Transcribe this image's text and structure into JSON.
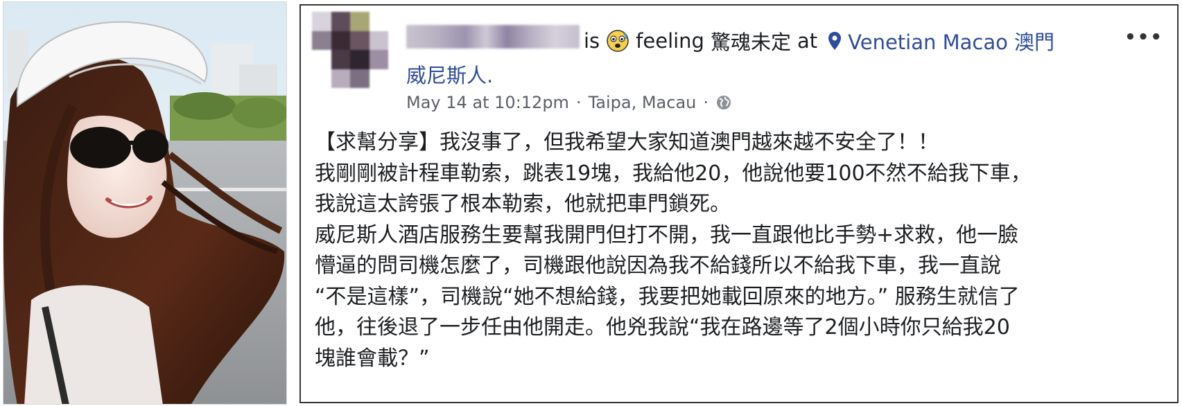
{
  "post": {
    "verb_is": "is",
    "feeling_word": "feeling",
    "feeling_text": "驚魂未定",
    "at_word": "at",
    "location_line1": "Venetian Macao 澳門",
    "location_line2": "威尼斯人.",
    "more_icon": "•••",
    "timestamp": "May 14 at 10:12pm",
    "separator1": "·",
    "place": "Taipa, Macau",
    "separator2": "·",
    "body_lines": [
      "【求幫分享】我沒事了，但我希望大家知道澳門越來越不安全了！！",
      "我剛剛被計程車勒索，跳表19塊，我給他20，他說他要100不然不給我下車，",
      "我說這太誇張了根本勒索，他就把車門鎖死。",
      "威尼斯人酒店服務生要幫我開門但打不開，我一直跟他比手勢+求救，他一臉",
      "懵逼的問司機怎麼了，司機跟他說因為我不給錢所以不給我下車，我一直說",
      "“不是這樣”，司機說“她不想給錢，我要把她載回原來的地方。” 服務生就信了",
      "他，往後退了一步任由他開走。他兇我說“我在路邊等了2個小時你只給我20",
      "塊誰會載？”"
    ]
  },
  "colors": {
    "text": "#1c1e21",
    "link": "#2f4c9c",
    "meta": "#5b5f66",
    "border": "#333333"
  },
  "icons": {
    "feeling": "anxious-face-emoji",
    "location": "map-pin-icon",
    "privacy": "globe-icon",
    "menu": "more-options-icon"
  }
}
